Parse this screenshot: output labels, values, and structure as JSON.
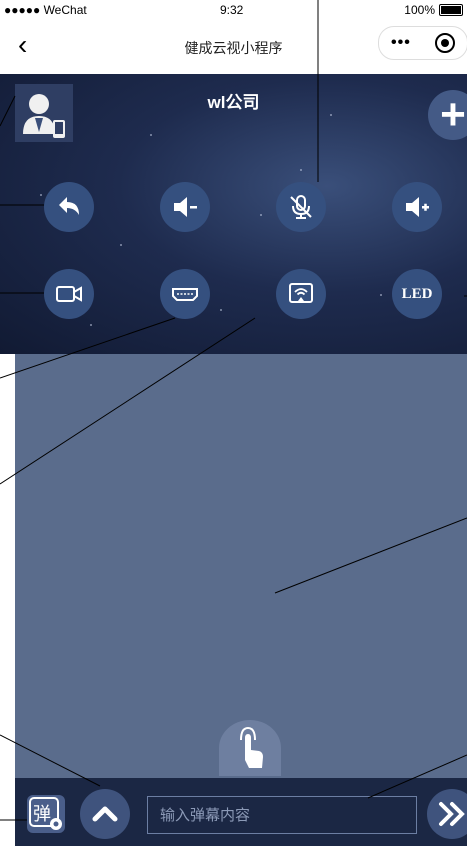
{
  "status_bar": {
    "carrier": "●●●●● WeChat",
    "time": "9:32",
    "battery": "100%"
  },
  "nav": {
    "back_icon": "chevron-left-icon",
    "title": "健成云视小程序",
    "more_icon": "more-dots-icon",
    "close_icon": "record-circle-icon"
  },
  "header": {
    "company": "wl公司",
    "avatar_icon": "user-device-icon",
    "add_icon": "plus-icon"
  },
  "controls": {
    "row1": [
      {
        "name": "undo-button",
        "icon": "undo-arrow-icon"
      },
      {
        "name": "volume-down-button",
        "icon": "volume-down-icon"
      },
      {
        "name": "mic-mute-button",
        "icon": "mic-off-icon"
      },
      {
        "name": "volume-up-button",
        "icon": "volume-up-icon"
      }
    ],
    "row2": [
      {
        "name": "camera-button",
        "icon": "video-camera-icon"
      },
      {
        "name": "hdmi-button",
        "icon": "hdmi-icon"
      },
      {
        "name": "screen-cast-button",
        "icon": "screen-cast-icon"
      },
      {
        "name": "led-button",
        "label": "LED"
      }
    ]
  },
  "bottom": {
    "danmu_icon": "danmu-settings-icon",
    "danmu_char": "弹",
    "up_icon": "chevron-up-icon",
    "input_placeholder": "输入弹幕内容",
    "send_icon": "double-chevron-right-icon",
    "touch_icon": "touch-hand-icon"
  },
  "colors": {
    "accent": "#35507f",
    "panel": "#5a6c8c",
    "bar": "#1b2744"
  }
}
